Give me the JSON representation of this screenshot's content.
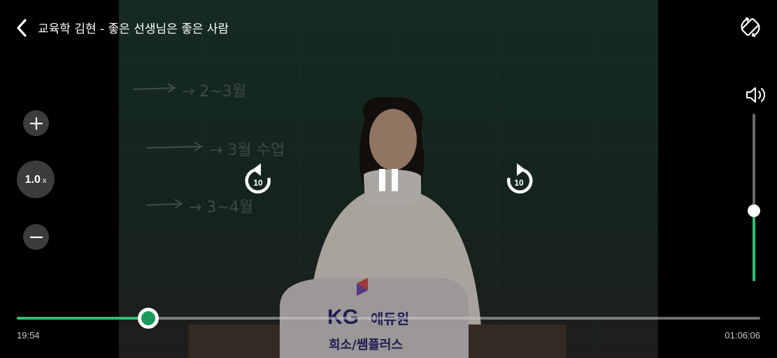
{
  "header": {
    "title": "교육학 김현 - 좋은 선생님은 좋은 사람",
    "back_icon": "chevron-left-icon",
    "rotate_icon": "screen-rotate-icon"
  },
  "speed": {
    "increase_icon": "plus-icon",
    "value": "1.0",
    "unit": "x",
    "decrease_icon": "minus-icon"
  },
  "playback": {
    "rewind_seconds": "10",
    "forward_seconds": "10",
    "state_icon": "pause-icon"
  },
  "volume": {
    "icon": "speaker-icon",
    "level": 0.42
  },
  "progress": {
    "current_time": "19:54",
    "total_time": "01:06:06",
    "fraction": 0.177
  },
  "video": {
    "podium_brand": "KG",
    "podium_brand_sub": "에듀원",
    "podium_caption": "희소/쌤플러스",
    "board_text": [
      "→ 2~3월",
      "→ 3월 수업",
      "→ 3~4월"
    ]
  },
  "colors": {
    "accent": "#2fbf71",
    "thumb": "#1a9a5a",
    "board": "#1f3a31"
  }
}
